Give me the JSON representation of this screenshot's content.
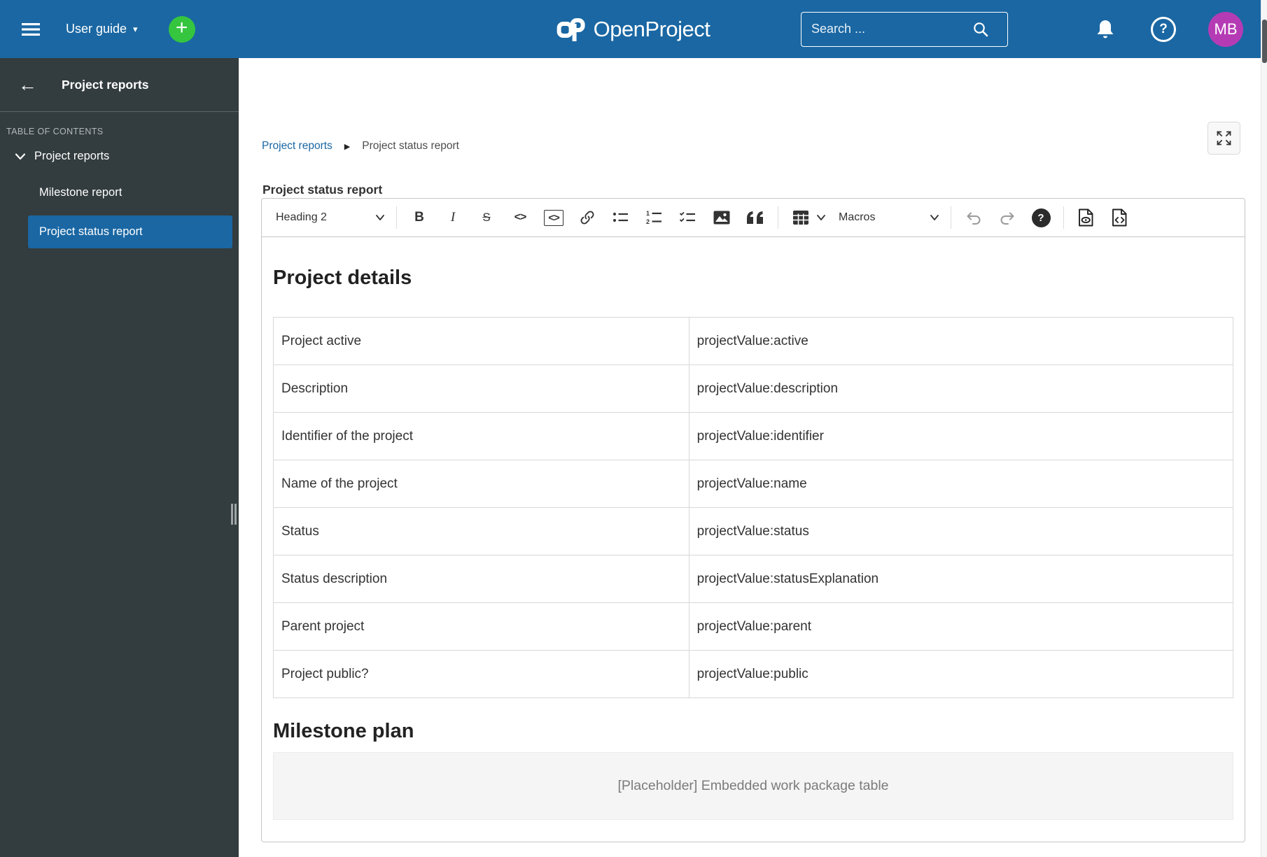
{
  "colors": {
    "header_bg": "#1A67A3",
    "accent_green": "#35C53F",
    "avatar_bg": "#B53BB5",
    "sidebar_bg": "#333C3E",
    "selected_item_bg": "#1A67A3",
    "link": "#1A67A3"
  },
  "icons": {
    "hamburger": "menu-bars",
    "plus": "+",
    "caret_down": "▾",
    "back_arrow": "←",
    "breadcrumb_chevron": "▶",
    "search": "magnifier",
    "apps_grid": "3x3-grid",
    "bell": "notification-bell",
    "help_mark": "?",
    "expand": "fullscreen-arrows"
  },
  "header": {
    "project_menu_label": "User guide",
    "logo_text": "OpenProject",
    "search_placeholder": "Search ...",
    "avatar_initials": "MB"
  },
  "sidebar": {
    "title": "Project reports",
    "toc_label": "TABLE OF CONTENTS",
    "root_item": "Project reports",
    "items": [
      {
        "label": "Milestone report",
        "selected": false
      },
      {
        "label": "Project status report",
        "selected": true
      }
    ]
  },
  "breadcrumb": {
    "link": "Project reports",
    "current": "Project status report"
  },
  "page": {
    "title": "Project status report"
  },
  "toolbar": {
    "heading_label": "Heading 2",
    "bold": "B",
    "italic": "I",
    "strike": "S",
    "inline_code": "<>",
    "code_block": "<>",
    "macros_label": "Macros",
    "help_mark": "?"
  },
  "content": {
    "section1_title": "Project details",
    "details_table": {
      "rows": [
        {
          "label": "Project active",
          "value": "projectValue:active"
        },
        {
          "label": "Description",
          "value": "projectValue:description"
        },
        {
          "label": "Identifier of the project",
          "value": "projectValue:identifier"
        },
        {
          "label": "Name of the project",
          "value": "projectValue:name"
        },
        {
          "label": "Status",
          "value": "projectValue:status"
        },
        {
          "label": "Status description",
          "value": "projectValue:statusExplanation"
        },
        {
          "label": "Parent project",
          "value": "projectValue:parent"
        },
        {
          "label": "Project public?",
          "value": "projectValue:public"
        }
      ]
    },
    "section2_title": "Milestone plan",
    "placeholder_text": "[Placeholder] Embedded work package table"
  }
}
